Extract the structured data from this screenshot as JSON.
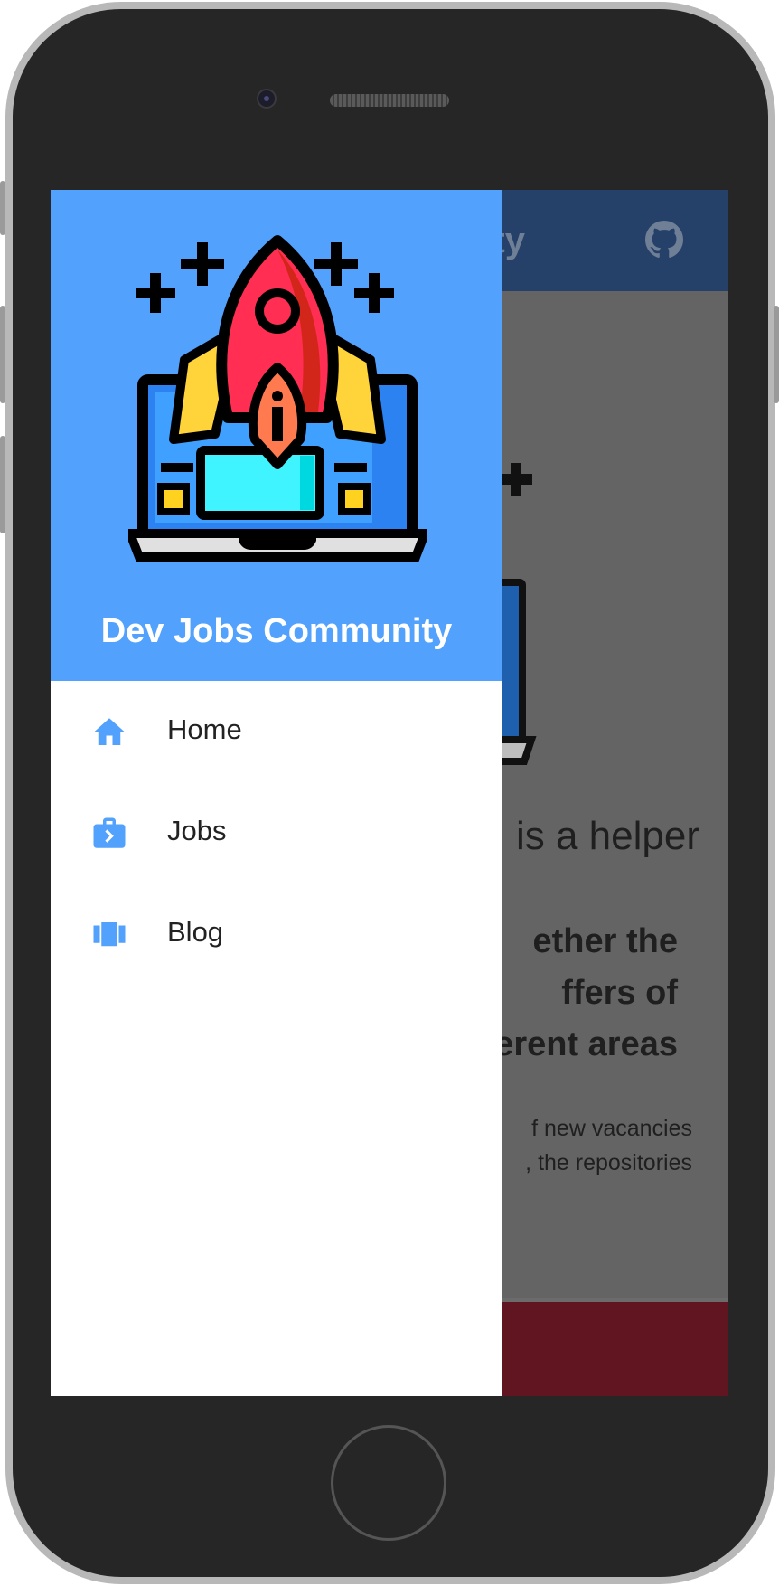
{
  "app": {
    "title_partial": "ty",
    "github_icon": "github-icon"
  },
  "drawer": {
    "title": "Dev Jobs Community",
    "logo_icon": "rocket-laptop-logo",
    "items": [
      {
        "label": "Home",
        "icon": "home-icon"
      },
      {
        "label": "Jobs",
        "icon": "briefcase-icon"
      },
      {
        "label": "Blog",
        "icon": "carousel-icon"
      }
    ]
  },
  "background": {
    "headline": "is a helper",
    "bold_lines": [
      "ether the",
      "ffers of",
      "erent areas"
    ],
    "small_lines": [
      "f new vacancies",
      ", the repositories"
    ]
  },
  "colors": {
    "drawer_header": "#52a1fd",
    "accent_icon": "#52a1fd",
    "appbar": "#25416a",
    "bottom_bar": "#611520"
  }
}
